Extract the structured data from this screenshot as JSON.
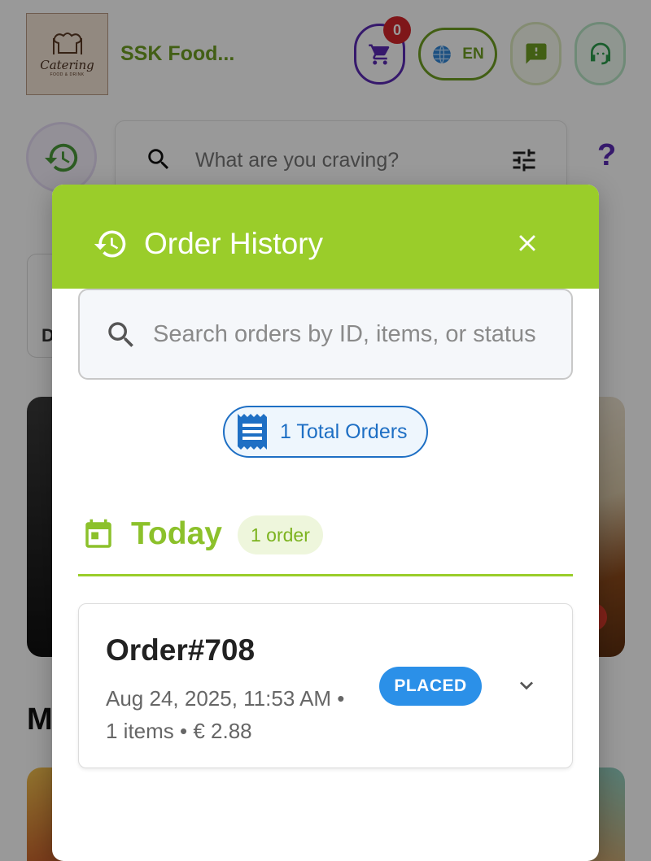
{
  "app": {
    "brand_name": "SSK Food...",
    "logo_text": "Catering",
    "logo_subtext": "FOOD & DRINK",
    "cart_count": "0",
    "language": "EN",
    "search_placeholder": "What are you craving?",
    "help_label": "?",
    "category_initial": "D",
    "section_initial": "M",
    "accent_green": "#9acd2a",
    "accent_purple": "#5b2bb5"
  },
  "dialog": {
    "title": "Order History",
    "search_placeholder": "Search orders by ID, items, or status",
    "total_orders_label": "1 Total Orders",
    "group": {
      "label": "Today",
      "count_label": "1 order"
    },
    "orders": [
      {
        "id_label": "Order#708",
        "datetime": "Aug 24, 2025, 11:53 AM •",
        "summary": "1 items • € 2.88",
        "status": "PLACED",
        "status_color": "#2b90e8"
      }
    ]
  },
  "icons": {
    "cart": "cart-icon",
    "globe": "globe-icon",
    "feedback": "feedback-icon",
    "support": "support-agent-icon",
    "history": "history-icon",
    "search": "search-icon",
    "filter": "filter-icon",
    "close": "close-icon",
    "receipt": "receipt-icon",
    "calendar": "calendar-icon",
    "chevron": "chevron-down-icon"
  }
}
